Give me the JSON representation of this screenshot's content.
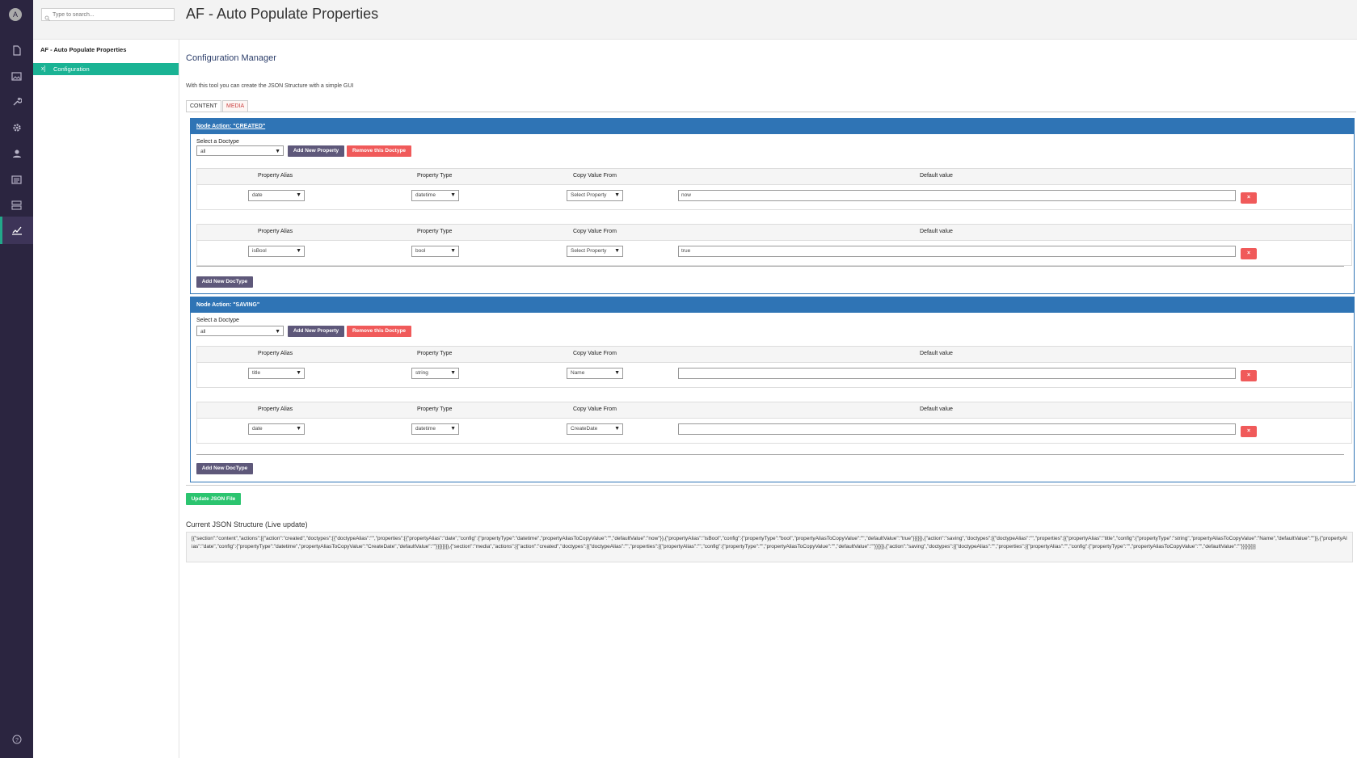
{
  "appbar": {
    "avatar_initial": "A",
    "items": [
      "content-icon",
      "media-icon",
      "settings-wrench-icon",
      "gear-icon",
      "members-icon",
      "forms-icon",
      "translation-icon",
      "analytics-pen-icon"
    ],
    "help_icon": "question-icon"
  },
  "tree": {
    "search_placeholder": "Type to search...",
    "root_label": "AF - Auto Populate Properties",
    "node_icon": "x]",
    "node_label": "Configuration"
  },
  "header": {
    "title": "AF - Auto Populate Properties"
  },
  "main": {
    "subtitle": "Configuration Manager",
    "intro": "With this tool you can create the JSON Structure with a simple GUI",
    "tabs": [
      {
        "label": "CONTENT"
      },
      {
        "label": "MEDIA"
      }
    ]
  },
  "labels": {
    "select_doctype": "Select a Doctype",
    "add_property": "Add New Property",
    "remove_doctype": "Remove this Doctype",
    "add_doctype": "Add New DocType",
    "col_alias": "Property Alias",
    "col_type": "Property Type",
    "col_copy": "Copy Value From",
    "col_default": "Default value",
    "delete_glyph": "×",
    "dropdown_arrow": "▼"
  },
  "sections": [
    {
      "title": "Node Action: \"CREATED\"",
      "doctype": "all",
      "rows": [
        {
          "alias": "date",
          "type": "datetime",
          "copy": "Select Property",
          "default": "now"
        },
        {
          "alias": "isBool",
          "type": "bool",
          "copy": "Select Property",
          "default": "true"
        }
      ]
    },
    {
      "title": "Node Action: \"SAVING\"",
      "doctype": "all",
      "rows": [
        {
          "alias": "title",
          "type": "string",
          "copy": "Name",
          "default": ""
        },
        {
          "alias": "date",
          "type": "datetime",
          "copy": "CreateDate",
          "default": ""
        }
      ]
    }
  ],
  "update_button": "Update JSON File",
  "json_title": "Current JSON Structure (Live update)",
  "json_text": "[{\"section\":\"content\",\"actions\":[{\"action\":\"created\",\"doctypes\":[{\"doctypeAlias\":\"\",\"properties\":[{\"propertyAlias\":\"date\",\"config\":{\"propertyType\":\"datetime\",\"propertyAliasToCopyValue\":\"\",\"defaultValue\":\"now\"}},{\"propertyAlias\":\"isBool\",\"config\":{\"propertyType\":\"bool\",\"propertyAliasToCopyValue\":\"\",\"defaultValue\":\"true\"}}]}]},{\"action\":\"saving\",\"doctypes\":[{\"doctypeAlias\":\"\",\"properties\":[{\"propertyAlias\":\"title\",\"config\":{\"propertyType\":\"string\",\"propertyAliasToCopyValue\":\"Name\",\"defaultValue\":\"\"}},{\"propertyAlias\":\"date\",\"config\":{\"propertyType\":\"datetime\",\"propertyAliasToCopyValue\":\"CreateDate\",\"defaultValue\":\"\"}}]}]}]},{\"section\":\"media\",\"actions\":[{\"action\":\"created\",\"doctypes\":[{\"doctypeAlias\":\"\",\"properties\":[{\"propertyAlias\":\"\",\"config\":{\"propertyType\":\"\",\"propertyAliasToCopyValue\":\"\",\"defaultValue\":\"\"}}]}]},{\"action\":\"saving\",\"doctypes\":[{\"doctypeAlias\":\"\",\"properties\":[{\"propertyAlias\":\"\",\"config\":{\"propertyType\":\"\",\"propertyAliasToCopyValue\":\"\",\"defaultValue\":\"\"}}]}]}]}]"
}
